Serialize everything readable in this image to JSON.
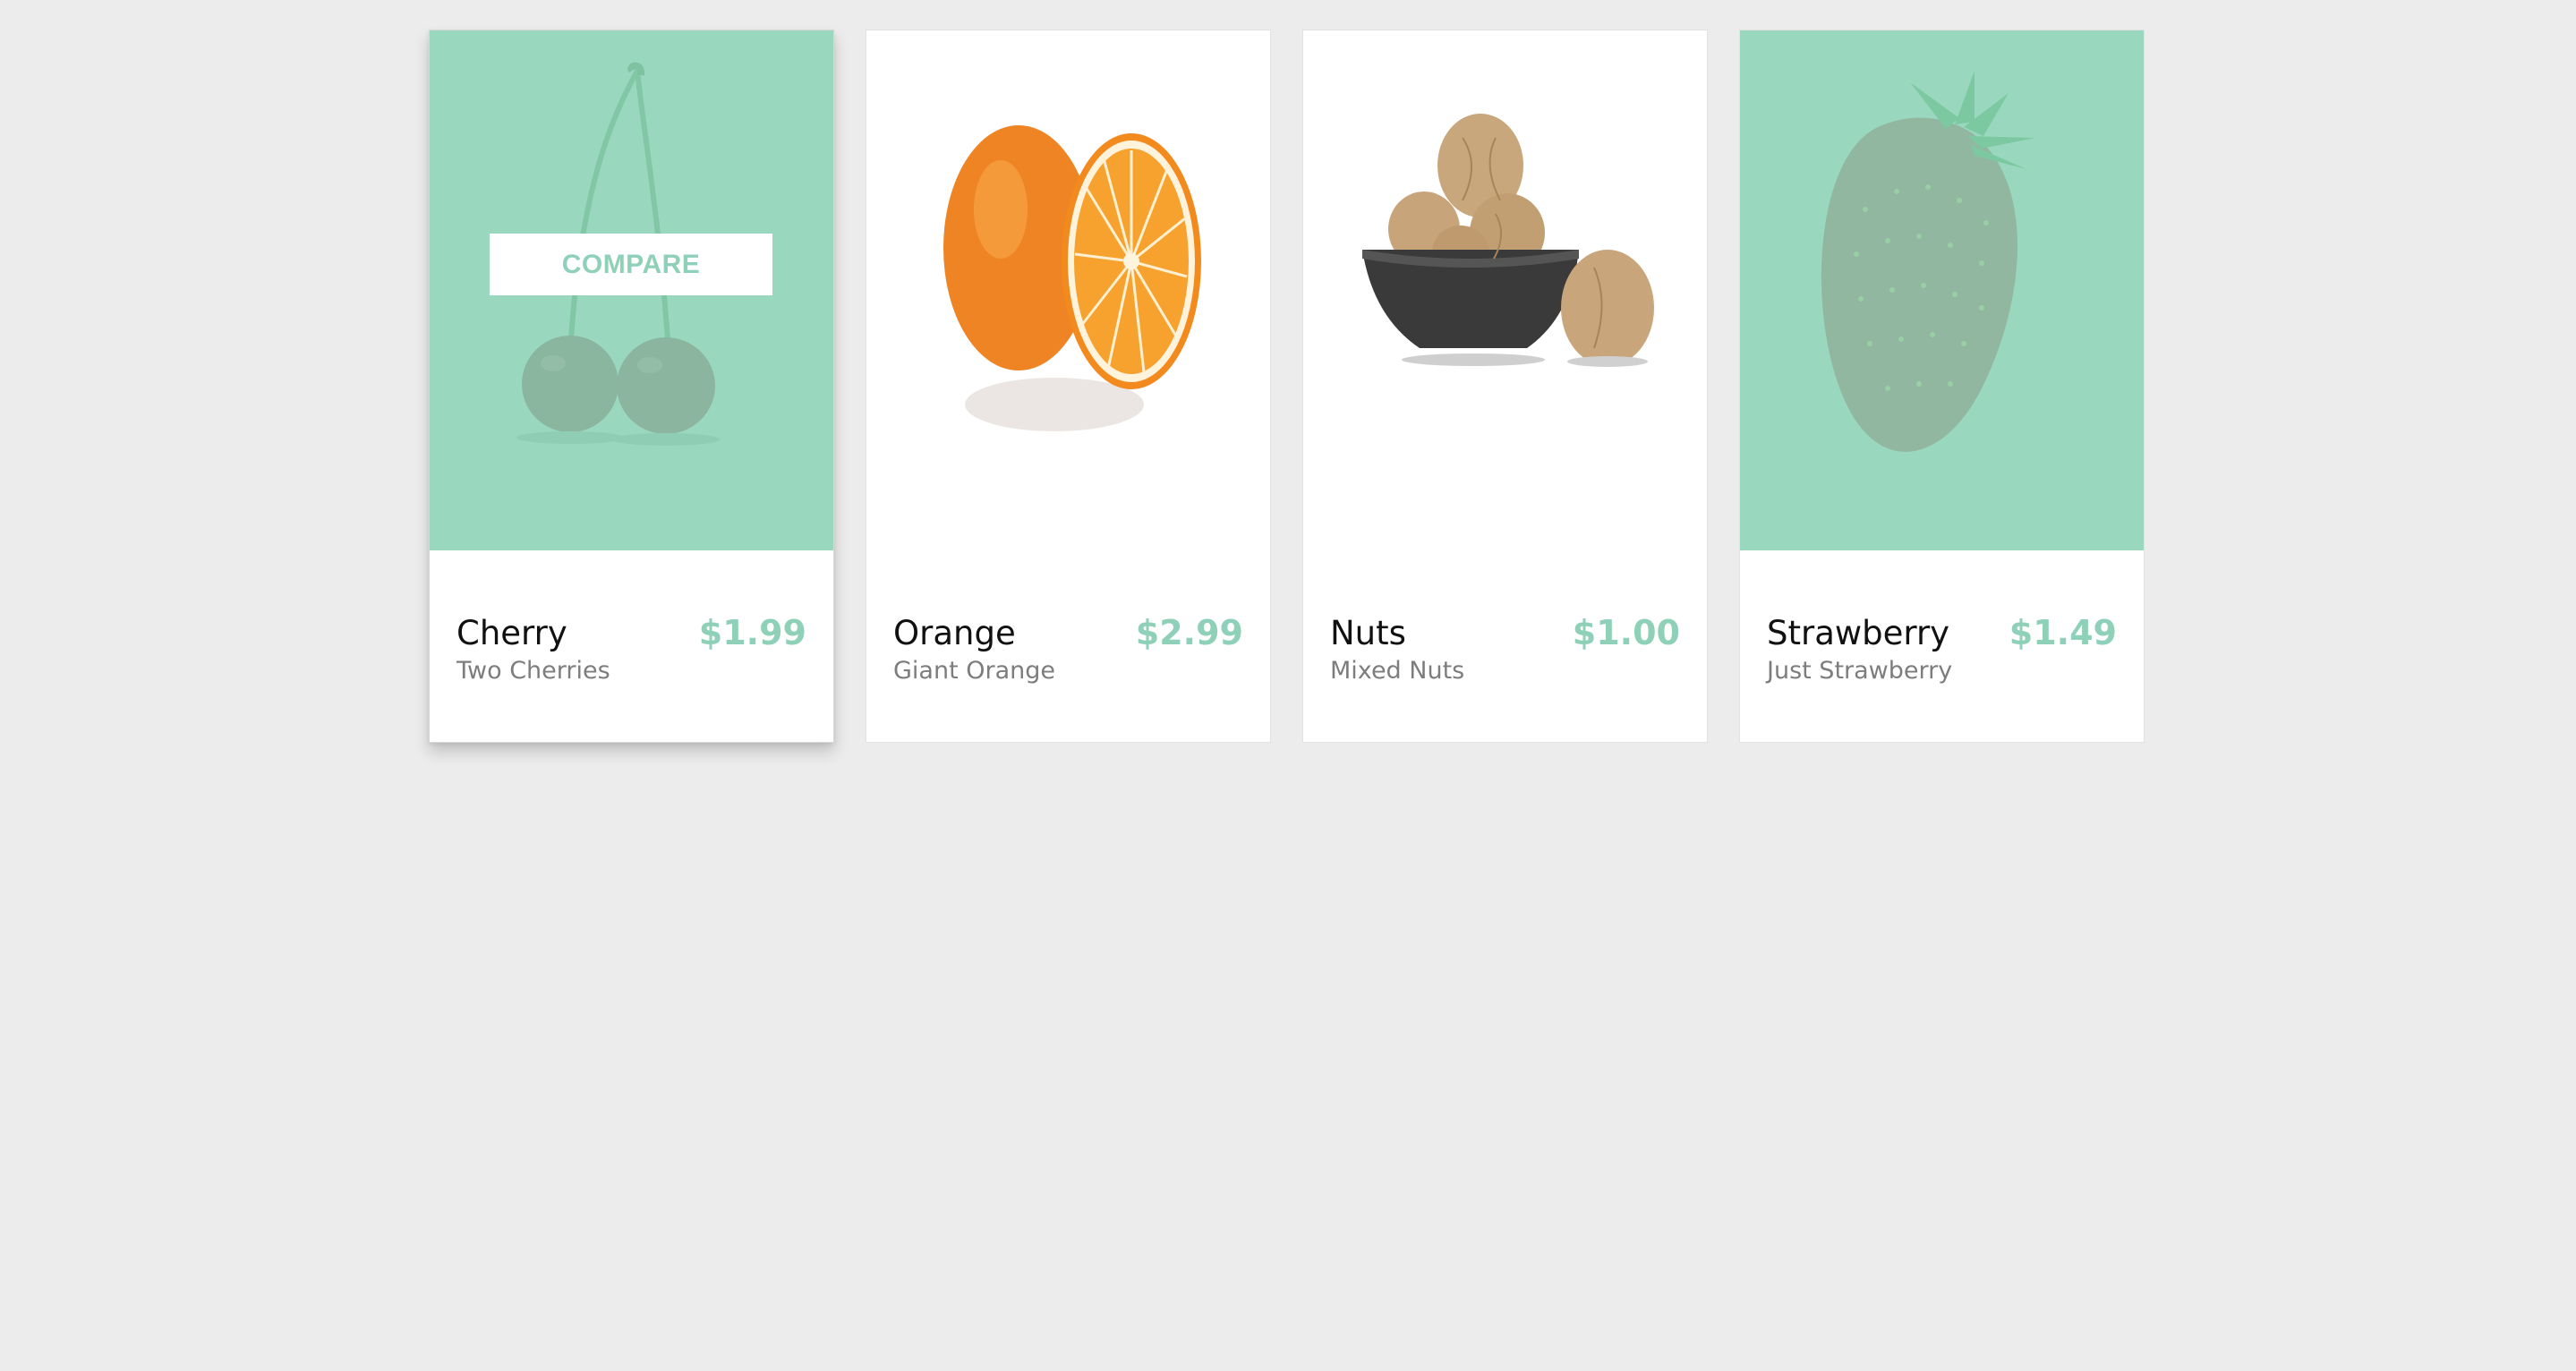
{
  "compare_label": "COMPARE",
  "accent_color": "#8ed1b8",
  "products": [
    {
      "name": "Cherry",
      "subtitle": "Two Cherries",
      "price": "$1.99",
      "image": "cherry-image",
      "highlighted": true
    },
    {
      "name": "Orange",
      "subtitle": "Giant Orange",
      "price": "$2.99",
      "image": "orange-image",
      "highlighted": false
    },
    {
      "name": "Nuts",
      "subtitle": "Mixed Nuts",
      "price": "$1.00",
      "image": "nuts-image",
      "highlighted": false
    },
    {
      "name": "Strawberry",
      "subtitle": "Just Strawberry",
      "price": "$1.49",
      "image": "strawberry-image",
      "highlighted": true
    }
  ]
}
